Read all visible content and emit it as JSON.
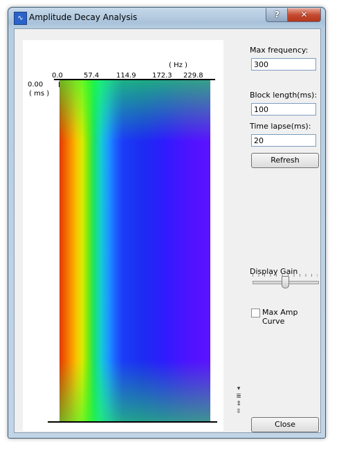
{
  "window": {
    "title": "Amplitude Decay Analysis",
    "help_label": "?",
    "close_label": "✕",
    "icon": "waveform-app-icon"
  },
  "plot": {
    "x_unit": "( Hz )",
    "y_zero": "0.00",
    "y_unit": "( ms )",
    "x_ticks": [
      "0.0",
      "57.4",
      "114.9",
      "172.3",
      "229.8"
    ]
  },
  "controls": {
    "max_frequency_label": "Max frequency:",
    "max_frequency_value": "300",
    "block_length_label": "Block length(ms):",
    "block_length_value": "100",
    "time_lapse_label": "Time lapse(ms):",
    "time_lapse_value": "20",
    "refresh_label": "Refresh",
    "display_gain_label": "Display Gain",
    "display_gain_level": 0.5,
    "max_amp_curve_label": "Max Amp Curve",
    "max_amp_curve_checked": false,
    "close_label": "Close"
  }
}
